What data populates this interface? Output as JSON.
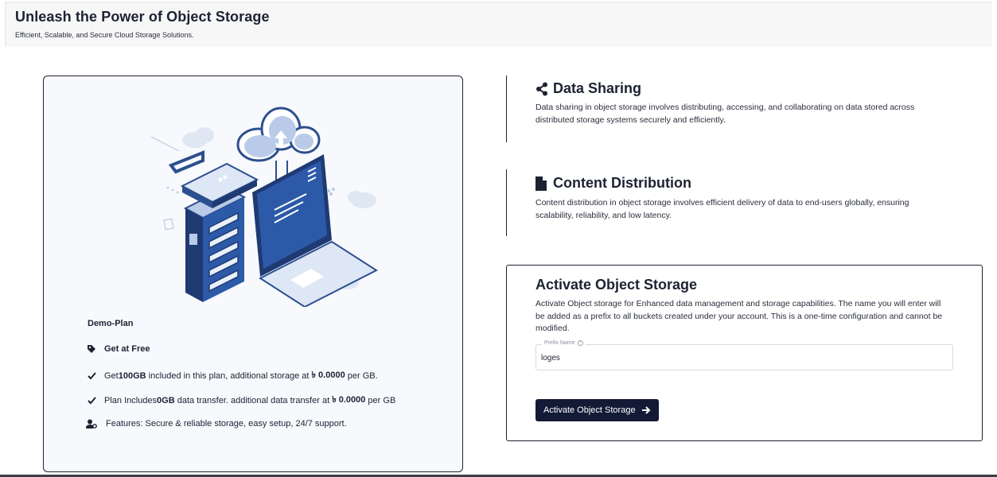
{
  "header": {
    "title": "Unleash the Power of Object Storage",
    "subtitle": "Efficient, Scalable, and Secure Cloud Storage Solutions."
  },
  "plan": {
    "name": "Demo-Plan",
    "rows": [
      {
        "icon": "tag-icon",
        "pre": "Get at Free",
        "bold": "",
        "post": ""
      },
      {
        "icon": "check-icon",
        "pre": "Get ",
        "bold": "100GB",
        "post": " included in this plan, additional storage at ",
        "bold2": "৳ 0.0000",
        "post2": " per GB."
      },
      {
        "icon": "check-icon",
        "pre": "Plan Includes ",
        "bold": "0GB",
        "post": " data transfer. additional data transfer at ",
        "bold2": "৳ 0.0000",
        "post2": " per GB"
      },
      {
        "icon": "user-cog-icon",
        "pre": "Features: Secure & reliable storage, easy setup, 24/7 support.",
        "bold": "",
        "post": ""
      }
    ]
  },
  "features": [
    {
      "icon": "share-icon",
      "title": "Data Sharing",
      "desc": "Data sharing in object storage involves distributing, accessing, and collaborating on data stored across distributed storage systems securely and efficiently."
    },
    {
      "icon": "file-icon",
      "title": "Content Distribution",
      "desc": "Content distribution in object storage involves efficient delivery of data to end-users globally, ensuring scalability, reliability, and low latency."
    }
  ],
  "activate": {
    "title": "Activate Object Storage",
    "desc": "Activate Object storage for Enhanced data management and storage capabilities. The name you will enter will be added as a prefix to all buckets created under your account. This is a one-time configuration and cannot be modified.",
    "field_label": "Prefix Name",
    "field_value": "loges",
    "button_label": "Activate Object Storage"
  },
  "colors": {
    "primary": "#131a35",
    "text": "#1d2233",
    "illustration": "#2c4f8f",
    "illustration_light": "#b9cbe8"
  }
}
